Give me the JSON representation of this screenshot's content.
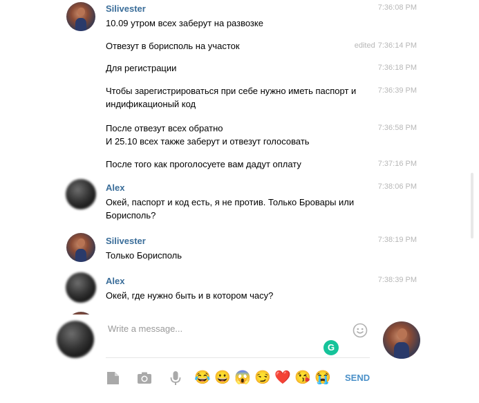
{
  "messages": [
    {
      "sender": "Silivester",
      "text": "10.09 утром всех заберут на развозке",
      "time": "7:36:08 PM"
    },
    {
      "text": "Отвезут в борисполь на участок",
      "edited": "edited",
      "time": "7:36:14 PM"
    },
    {
      "text": "Для регистрации",
      "time": "7:36:18 PM"
    },
    {
      "text": "Чтобы зарегистрироваться при себе нужно иметь паспорт и индификационый код",
      "time": "7:36:39 PM"
    },
    {
      "text_lines": [
        "После отвезут всех обратно",
        "И 25.10 всех также заберут и отвезут голосовать"
      ],
      "time": "7:36:58 PM"
    },
    {
      "text": "После того как проголосуете вам дадут оплату",
      "time": "7:37:16 PM"
    },
    {
      "sender": "Alex",
      "text": "Окей, паспорт и код есть, я не против. Только Бровары или Борисполь?",
      "time": "7:38:06 PM"
    },
    {
      "sender": "Silivester",
      "text": "Только Борисполь",
      "time": "7:38:19 PM"
    },
    {
      "sender": "Alex",
      "text": "Окей, где нужно быть и в котором часу?",
      "time": "7:38:39 PM"
    }
  ],
  "composer": {
    "placeholder": "Write a message...",
    "send_label": "SEND",
    "grammarly_label": "G",
    "emojis": [
      "😂",
      "😀",
      "😱",
      "😏",
      "❤️",
      "😘",
      "😭"
    ]
  },
  "colors": {
    "sender_name": "#3a6d99",
    "timestamp": "#b7b7b7",
    "send": "#4a90c8",
    "grammarly": "#15c39a"
  },
  "icons": [
    "attach-file-icon",
    "camera-icon",
    "microphone-icon",
    "emoji-smile-icon"
  ]
}
